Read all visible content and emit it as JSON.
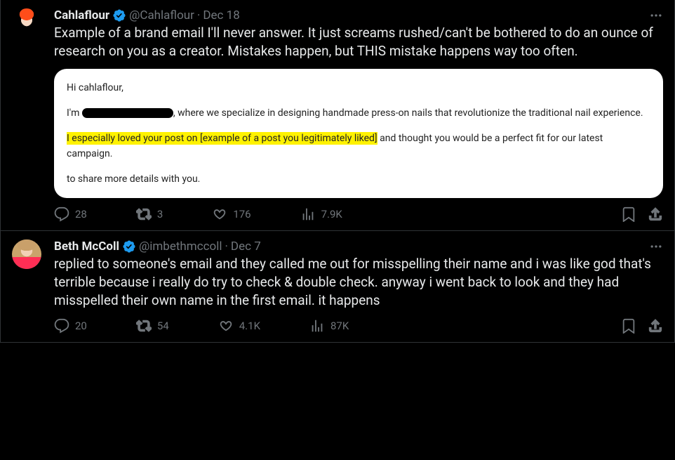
{
  "tweets": [
    {
      "name": "Cahlaflour",
      "handle": "@Cahlaflour",
      "sep": " · ",
      "date": "Dec 18",
      "text": "Example of a brand email I'll never answer. It just screams rushed/can't be bothered to do an ounce of research on you as a creator. Mistakes happen, but THIS mistake happens way too often.",
      "email": {
        "greeting": "Hi cahlaflour,",
        "line2_a": "I'm ",
        "line2_b": ", where we specialize in designing handmade press-on nails that revolutionize the traditional nail experience.",
        "highlight": "I especially loved your post on [example of a post you legitimately liked]",
        "line3_rest": " and thought you would be a perfect fit for our latest campaign.",
        "line4": "to share more details with you."
      },
      "metrics": {
        "replies": "28",
        "retweets": "3",
        "likes": "176",
        "views": "7.9K"
      }
    },
    {
      "name": "Beth McColl",
      "handle": "@imbethmccoll",
      "sep": " · ",
      "date": "Dec 7",
      "text": "replied to someone's email and they called me out for misspelling their name and i was like god that's terrible because i really do try to check & double check. anyway i went back to look and they had misspelled their own name in the first email. it happens",
      "metrics": {
        "replies": "20",
        "retweets": "54",
        "likes": "4.1K",
        "views": "87K"
      }
    }
  ]
}
